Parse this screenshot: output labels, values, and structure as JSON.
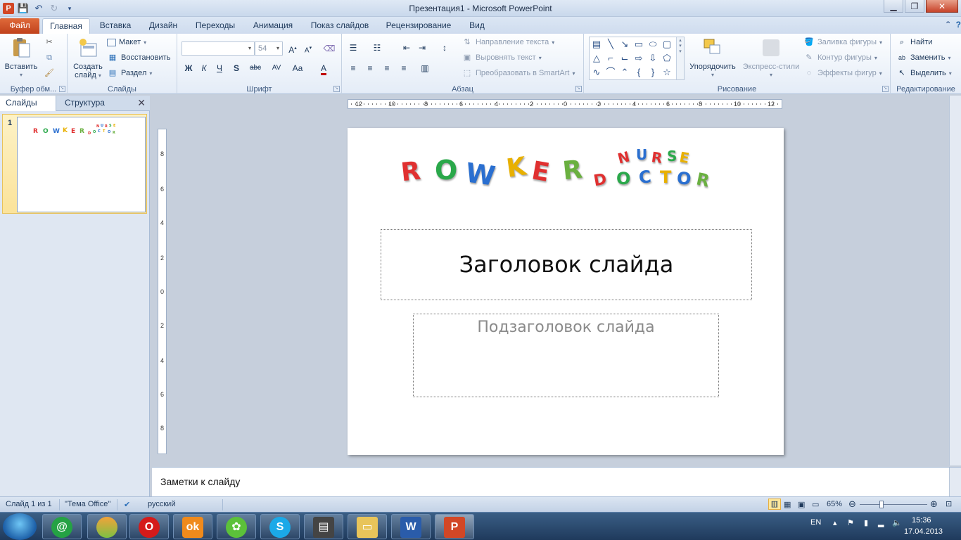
{
  "window": {
    "title": "Презентация1  -  Microsoft PowerPoint",
    "app_icon": "P"
  },
  "tabs": [
    {
      "label": "Файл"
    },
    {
      "label": "Главная"
    },
    {
      "label": "Вставка"
    },
    {
      "label": "Дизайн"
    },
    {
      "label": "Переходы"
    },
    {
      "label": "Анимация"
    },
    {
      "label": "Показ слайдов"
    },
    {
      "label": "Рецензирование"
    },
    {
      "label": "Вид"
    }
  ],
  "ribbon": {
    "clipboard": {
      "label": "Буфер обм...",
      "paste": "Вставить"
    },
    "slides": {
      "label": "Слайды",
      "create": "Создать",
      "create2": "слайд",
      "layout": "Макет",
      "reset": "Восстановить",
      "section": "Раздел"
    },
    "font": {
      "label": "Шрифт",
      "size": "54"
    },
    "paragraph": {
      "label": "Абзац",
      "text_direction": "Направление текста",
      "align_text": "Выровнять текст",
      "smartart": "Преобразовать в SmartArt"
    },
    "drawing": {
      "label": "Рисование",
      "arrange": "Упорядочить",
      "quick_styles": "Экспресс-стили",
      "shape_fill": "Заливка фигуры",
      "shape_outline": "Контур фигуры",
      "shape_effects": "Эффекты фигур"
    },
    "editing": {
      "label": "Редактирование",
      "find": "Найти",
      "replace": "Заменить",
      "select": "Выделить"
    }
  },
  "left_panel": {
    "tab_slides": "Слайды",
    "tab_outline": "Структура",
    "slide_number": "1"
  },
  "slide": {
    "logo_main": [
      "R",
      "O",
      "W",
      "K",
      "E",
      "R"
    ],
    "logo_top": [
      "N",
      "U",
      "R",
      "S",
      "E"
    ],
    "logo_bottom": [
      "D",
      "O",
      "C",
      "T",
      "O",
      "R"
    ],
    "title_placeholder": "Заголовок слайда",
    "subtitle_placeholder": "Подзаголовок слайда"
  },
  "notes": {
    "placeholder": "Заметки к слайду"
  },
  "ruler": {
    "h_ticks": [
      "12",
      "10",
      "8",
      "6",
      "4",
      "2",
      "0",
      "2",
      "4",
      "6",
      "8",
      "10",
      "12"
    ],
    "v_ticks": [
      "8",
      "6",
      "4",
      "2",
      "0",
      "2",
      "4",
      "6",
      "8"
    ]
  },
  "status": {
    "slide_count": "Слайд 1 из 1",
    "theme": "\"Тема Office\"",
    "language": "русский",
    "zoom": "65%"
  },
  "taskbar": {
    "lang": "EN",
    "time": "15:36",
    "date": "17.04.2013"
  }
}
